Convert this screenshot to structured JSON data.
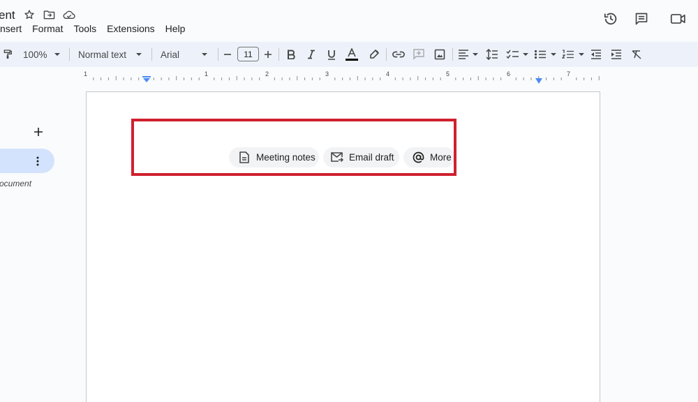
{
  "app": {
    "document_title": "ent",
    "menus": [
      "nsert",
      "Format",
      "Tools",
      "Extensions",
      "Help"
    ]
  },
  "header_icons": [
    "star-icon",
    "move-to-folder-icon",
    "cloud-saved-icon",
    "version-history-icon",
    "comments-icon",
    "meet-icon"
  ],
  "toolbar": {
    "zoom": "100%",
    "style": "Normal text",
    "font": "Arial",
    "font_size": "11",
    "icons": [
      "paint-format-icon",
      "decrease-font-size-icon",
      "increase-font-size-icon",
      "bold-icon",
      "italic-icon",
      "underline-icon",
      "text-color-icon",
      "highlight-color-icon",
      "insert-link-icon",
      "add-comment-icon",
      "insert-image-icon",
      "align-icon",
      "line-spacing-icon",
      "checklist-icon",
      "bulleted-list-icon",
      "numbered-list-icon",
      "decrease-indent-icon",
      "increase-indent-icon",
      "clear-formatting-icon"
    ],
    "text_color": "#000000"
  },
  "ruler": {
    "numbers": [
      "1",
      "1",
      "2",
      "3",
      "4",
      "5",
      "6",
      "7"
    ],
    "marker_color": "#4b8bf4"
  },
  "outline": {
    "label": "ocument"
  },
  "chips": [
    {
      "label": "Meeting notes",
      "icon": "document-icon"
    },
    {
      "label": "Email draft",
      "icon": "email-draft-icon"
    },
    {
      "label": "More",
      "icon": "at-sign-icon"
    }
  ],
  "colors": {
    "highlight_border": "#d0202f",
    "toolbar_bg": "#edf2fa",
    "outline_tab_bg": "#d3e3fd"
  }
}
